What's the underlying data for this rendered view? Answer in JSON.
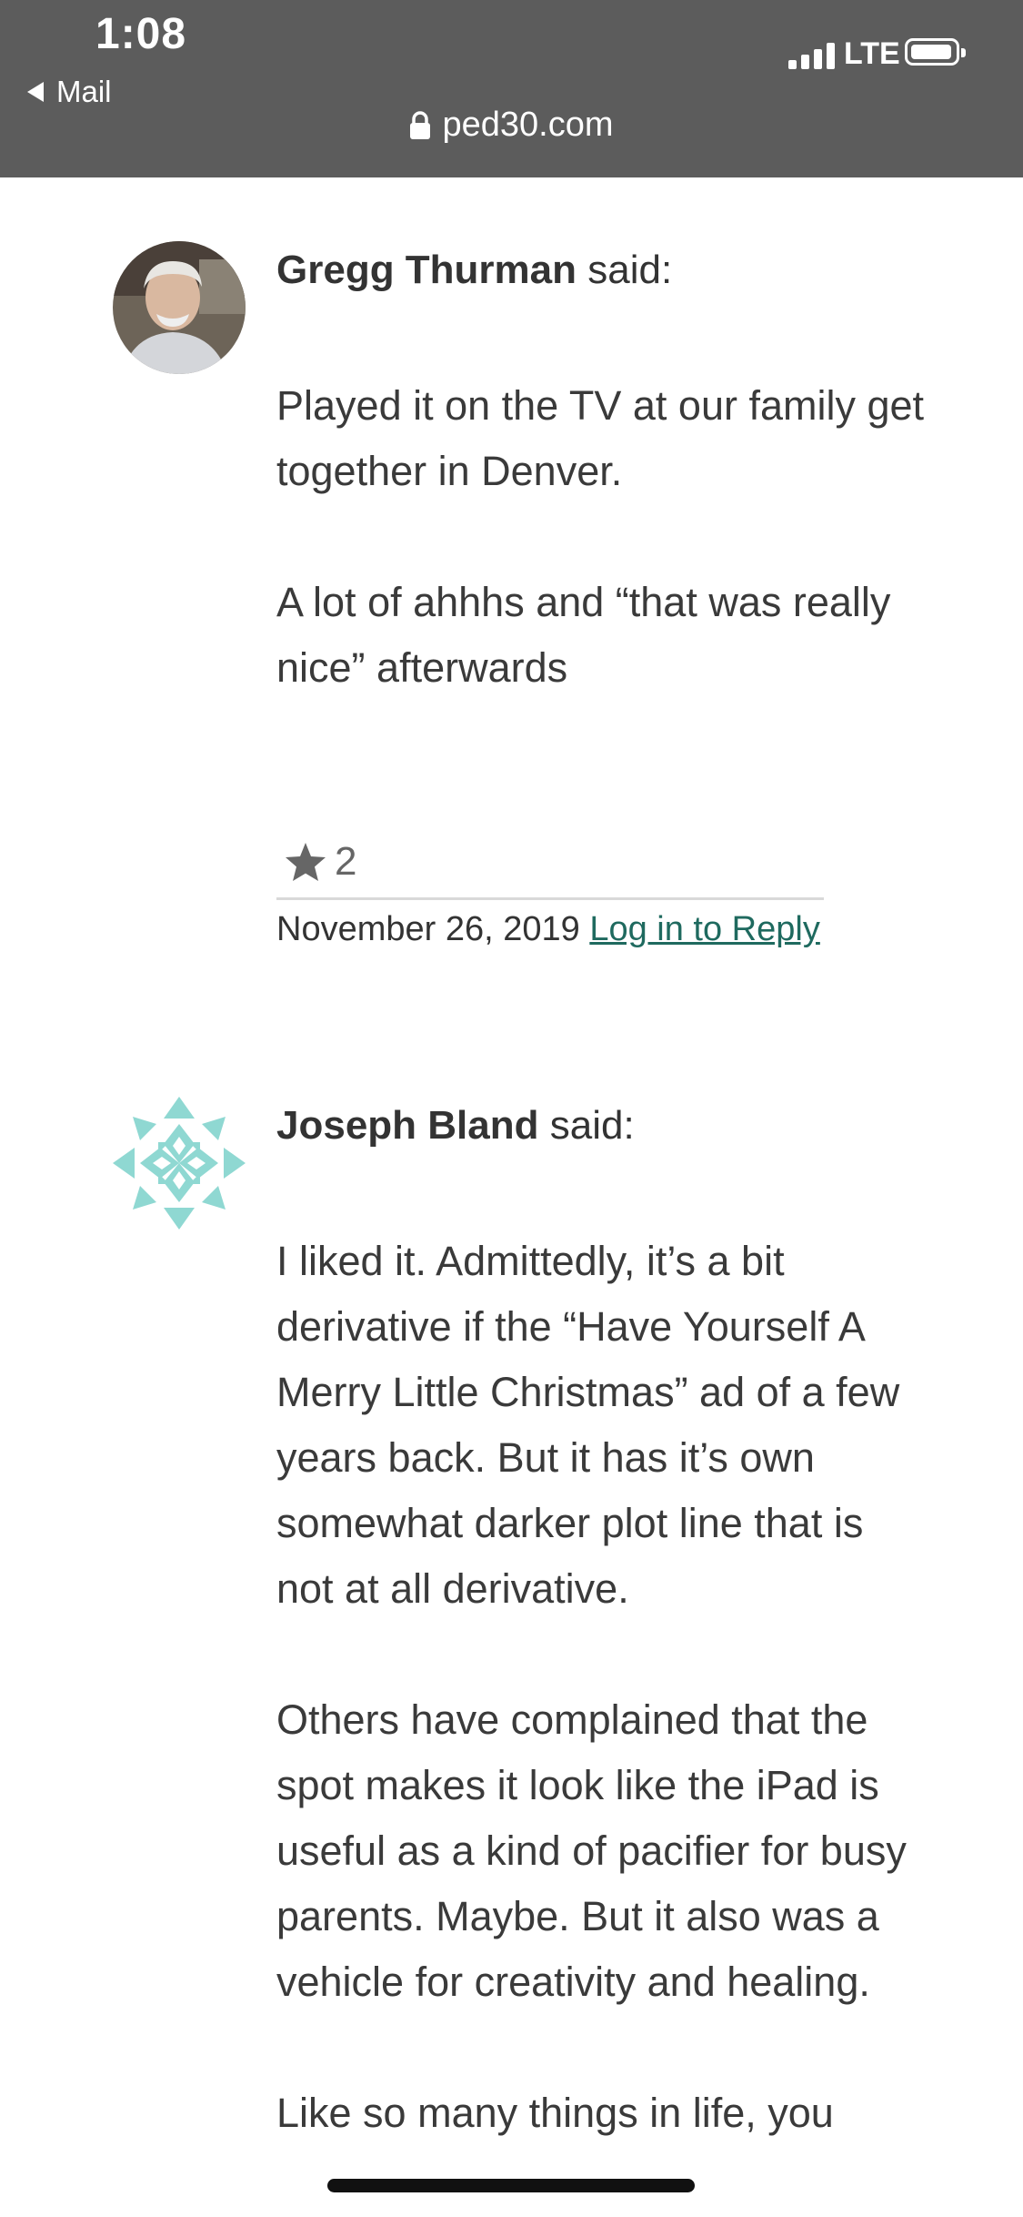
{
  "status_bar": {
    "time": "1:08",
    "back_label": "Mail",
    "network": "LTE"
  },
  "browser": {
    "url": "ped30.com"
  },
  "comments": [
    {
      "author": "Gregg Thurman",
      "said": "said:",
      "paragraphs": [
        "Played it on the TV at our family get together in Denver.",
        "A lot of ahhhs and “that was really nice” afterwards"
      ],
      "rating": "2",
      "date": "November 26, 2019",
      "reply_label": "Log in to Reply"
    },
    {
      "author": "Joseph Bland",
      "said": "said:",
      "paragraphs": [
        "I liked it. Admittedly, it’s a bit derivative if the “Have Yourself A Merry Little Christmas” ad of a few years back. But it has it’s own somewhat darker plot line that is not at all derivative.",
        "Others have complained that the spot makes it look like the iPad is useful as a kind of pacifier for busy parents. Maybe. But it also was a vehicle for creativity and healing.",
        "Like so many things in life, you"
      ]
    }
  ],
  "colors": {
    "top_bar": "#5c5c5c",
    "link": "#1f6a5f",
    "avatar_pattern": "#8fd8d2"
  },
  "icons": {
    "back": "left-triangle-icon",
    "signal": "signal-bars-icon",
    "battery": "battery-icon",
    "lock": "lock-icon",
    "star": "star-icon"
  }
}
